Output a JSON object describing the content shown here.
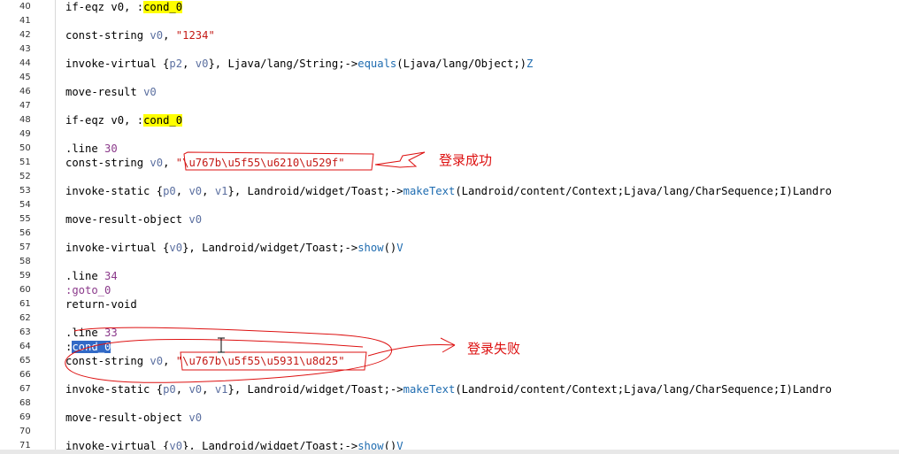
{
  "annotations": {
    "success": "登录成功",
    "failure": "登录失败"
  },
  "lines": [
    {
      "n": "40",
      "parts": [
        {
          "t": "if-eqz v0, ",
          "c": "d"
        },
        {
          "t": ":",
          "c": "d"
        },
        {
          "t": "cond_0",
          "c": "d",
          "hl": "y"
        }
      ]
    },
    {
      "n": "41",
      "parts": []
    },
    {
      "n": "42",
      "parts": [
        {
          "t": "const-string ",
          "c": "d"
        },
        {
          "t": "v0",
          "c": "r"
        },
        {
          "t": ", ",
          "c": "d"
        },
        {
          "t": "\"1234\"",
          "c": "s"
        }
      ]
    },
    {
      "n": "43",
      "parts": []
    },
    {
      "n": "44",
      "parts": [
        {
          "t": "invoke-virtual {",
          "c": "d"
        },
        {
          "t": "p2",
          "c": "r"
        },
        {
          "t": ", ",
          "c": "d"
        },
        {
          "t": "v0",
          "c": "r"
        },
        {
          "t": "}, Ljava/lang/String;->",
          "c": "d"
        },
        {
          "t": "equals",
          "c": "m"
        },
        {
          "t": "(Ljava/lang/Object;)",
          "c": "d"
        },
        {
          "t": "Z",
          "c": "m"
        }
      ]
    },
    {
      "n": "45",
      "parts": []
    },
    {
      "n": "46",
      "parts": [
        {
          "t": "move-result ",
          "c": "d"
        },
        {
          "t": "v0",
          "c": "r"
        }
      ]
    },
    {
      "n": "47",
      "parts": []
    },
    {
      "n": "48",
      "parts": [
        {
          "t": "if-eqz v0, ",
          "c": "d"
        },
        {
          "t": ":",
          "c": "d"
        },
        {
          "t": "cond_0",
          "c": "d",
          "hl": "y"
        }
      ]
    },
    {
      "n": "49",
      "parts": []
    },
    {
      "n": "50",
      "parts": [
        {
          "t": ".line ",
          "c": "d"
        },
        {
          "t": "30",
          "c": "o"
        }
      ]
    },
    {
      "n": "51",
      "parts": [
        {
          "t": "const-string ",
          "c": "d"
        },
        {
          "t": "v0",
          "c": "r"
        },
        {
          "t": ", ",
          "c": "d"
        },
        {
          "t": "\"\\u767b\\u5f55\\u6210\\u529f\"",
          "c": "s"
        }
      ]
    },
    {
      "n": "52",
      "parts": []
    },
    {
      "n": "53",
      "parts": [
        {
          "t": "invoke-static {",
          "c": "d"
        },
        {
          "t": "p0",
          "c": "r"
        },
        {
          "t": ", ",
          "c": "d"
        },
        {
          "t": "v0",
          "c": "r"
        },
        {
          "t": ", ",
          "c": "d"
        },
        {
          "t": "v1",
          "c": "r"
        },
        {
          "t": "}, Landroid/widget/Toast;->",
          "c": "d"
        },
        {
          "t": "makeText",
          "c": "m"
        },
        {
          "t": "(Landroid/content/Context;Ljava/lang/CharSequence;I)Landro",
          "c": "d"
        }
      ]
    },
    {
      "n": "54",
      "parts": []
    },
    {
      "n": "55",
      "parts": [
        {
          "t": "move-result-object ",
          "c": "d"
        },
        {
          "t": "v0",
          "c": "r"
        }
      ]
    },
    {
      "n": "56",
      "parts": []
    },
    {
      "n": "57",
      "parts": [
        {
          "t": "invoke-virtual {",
          "c": "d"
        },
        {
          "t": "v0",
          "c": "r"
        },
        {
          "t": "}, Landroid/widget/Toast;->",
          "c": "d"
        },
        {
          "t": "show",
          "c": "m"
        },
        {
          "t": "()",
          "c": "d"
        },
        {
          "t": "V",
          "c": "m"
        }
      ]
    },
    {
      "n": "58",
      "parts": []
    },
    {
      "n": "59",
      "parts": [
        {
          "t": ".line ",
          "c": "d"
        },
        {
          "t": "34",
          "c": "o"
        }
      ]
    },
    {
      "n": "60",
      "parts": [
        {
          "t": ":goto_0",
          "c": "o"
        }
      ]
    },
    {
      "n": "61",
      "parts": [
        {
          "t": "return-void",
          "c": "d"
        }
      ]
    },
    {
      "n": "62",
      "parts": []
    },
    {
      "n": "63",
      "parts": [
        {
          "t": ".line ",
          "c": "d"
        },
        {
          "t": "33",
          "c": "o"
        }
      ]
    },
    {
      "n": "64",
      "parts": [
        {
          "t": ":",
          "c": "d"
        },
        {
          "t": "cond_0",
          "c": "d",
          "hl": "b"
        }
      ]
    },
    {
      "n": "65",
      "parts": [
        {
          "t": "const-string ",
          "c": "d"
        },
        {
          "t": "v0",
          "c": "r"
        },
        {
          "t": ", ",
          "c": "d"
        },
        {
          "t": "\"\\u767b\\u5f55\\u5931\\u8d25\"",
          "c": "s"
        }
      ]
    },
    {
      "n": "66",
      "parts": []
    },
    {
      "n": "67",
      "parts": [
        {
          "t": "invoke-static {",
          "c": "d"
        },
        {
          "t": "p0",
          "c": "r"
        },
        {
          "t": ", ",
          "c": "d"
        },
        {
          "t": "v0",
          "c": "r"
        },
        {
          "t": ", ",
          "c": "d"
        },
        {
          "t": "v1",
          "c": "r"
        },
        {
          "t": "}, Landroid/widget/Toast;->",
          "c": "d"
        },
        {
          "t": "makeText",
          "c": "m"
        },
        {
          "t": "(Landroid/content/Context;Ljava/lang/CharSequence;I)Landro",
          "c": "d"
        }
      ]
    },
    {
      "n": "68",
      "parts": []
    },
    {
      "n": "69",
      "parts": [
        {
          "t": "move-result-object ",
          "c": "d"
        },
        {
          "t": "v0",
          "c": "r"
        }
      ]
    },
    {
      "n": "70",
      "parts": []
    },
    {
      "n": "71",
      "parts": [
        {
          "t": "invoke-virtual {",
          "c": "d"
        },
        {
          "t": "v0",
          "c": "r"
        },
        {
          "t": "}, Landroid/widget/Toast;->",
          "c": "d"
        },
        {
          "t": "show",
          "c": "m"
        },
        {
          "t": "()",
          "c": "d"
        },
        {
          "t": "V",
          "c": "m"
        }
      ]
    }
  ]
}
